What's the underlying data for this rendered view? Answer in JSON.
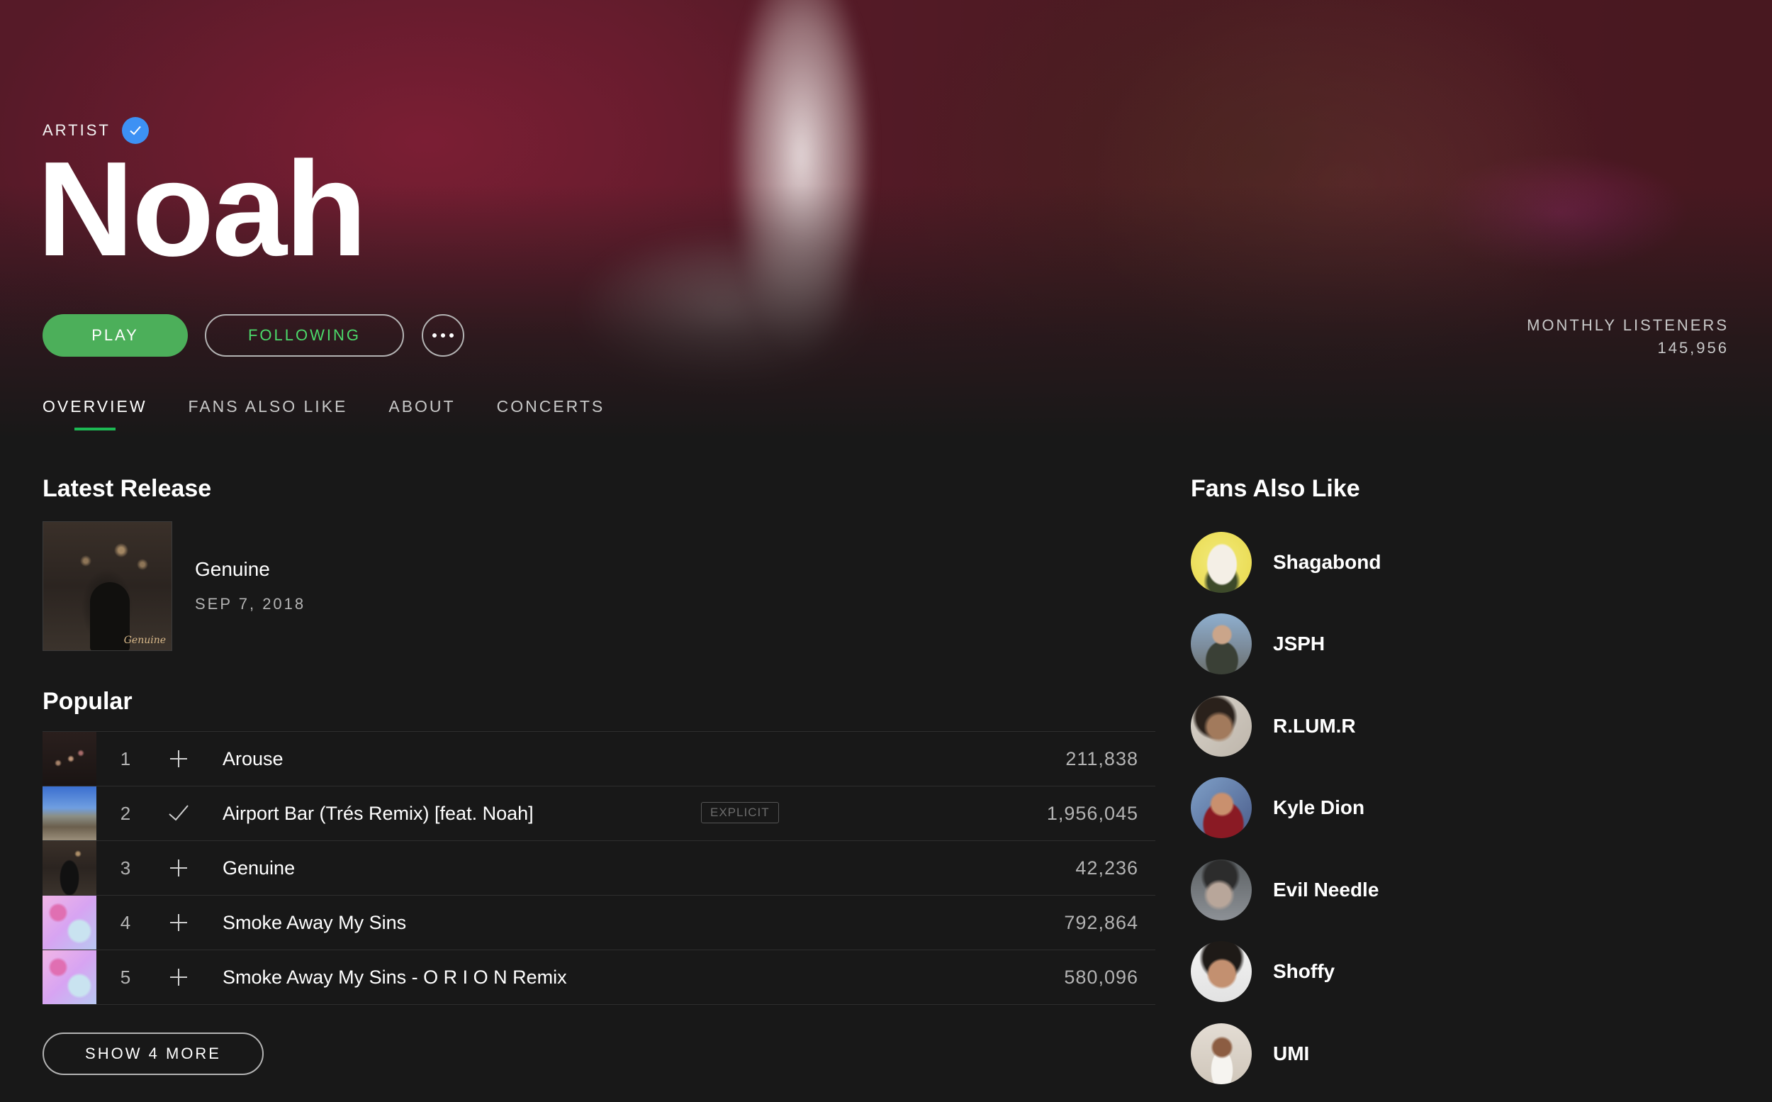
{
  "header": {
    "type_label": "ARTIST",
    "artist_name": "Noah",
    "play_label": "PLAY",
    "following_label": "FOLLOWING",
    "monthly_listeners_label": "MONTHLY LISTENERS",
    "monthly_listeners_value": "145,956"
  },
  "tabs": [
    {
      "label": "OVERVIEW",
      "active": true
    },
    {
      "label": "FANS ALSO LIKE",
      "active": false
    },
    {
      "label": "ABOUT",
      "active": false
    },
    {
      "label": "CONCERTS",
      "active": false
    }
  ],
  "latest_release": {
    "section_title": "Latest Release",
    "name": "Genuine",
    "date": "SEP 7, 2018",
    "cover_text": "Genuine"
  },
  "popular": {
    "section_title": "Popular",
    "tracks": [
      {
        "number": "1",
        "title": "Arouse",
        "plays": "211,838",
        "saved": false,
        "explicit": ""
      },
      {
        "number": "2",
        "title": "Airport Bar (Trés Remix) [feat. Noah]",
        "plays": "1,956,045",
        "saved": true,
        "explicit": "EXPLICIT"
      },
      {
        "number": "3",
        "title": "Genuine",
        "plays": "42,236",
        "saved": false,
        "explicit": ""
      },
      {
        "number": "4",
        "title": "Smoke Away My Sins",
        "plays": "792,864",
        "saved": false,
        "explicit": ""
      },
      {
        "number": "5",
        "title": "Smoke Away My Sins - O R I O N Remix",
        "plays": "580,096",
        "saved": false,
        "explicit": ""
      }
    ],
    "show_more_label": "SHOW 4 MORE"
  },
  "fans_also_like": {
    "section_title": "Fans Also Like",
    "artists": [
      {
        "name": "Shagabond"
      },
      {
        "name": "JSPH"
      },
      {
        "name": "R.LUM.R"
      },
      {
        "name": "Kyle Dion"
      },
      {
        "name": "Evil Needle"
      },
      {
        "name": "Shoffy"
      },
      {
        "name": "UMI"
      }
    ]
  },
  "colors": {
    "accent_green": "#1db954",
    "background": "#181818",
    "verified_blue": "#3d91f4"
  },
  "icons": {
    "verified": "verified-check-icon",
    "more": "more-dots-icon",
    "add": "plus-icon",
    "saved": "check-icon"
  }
}
